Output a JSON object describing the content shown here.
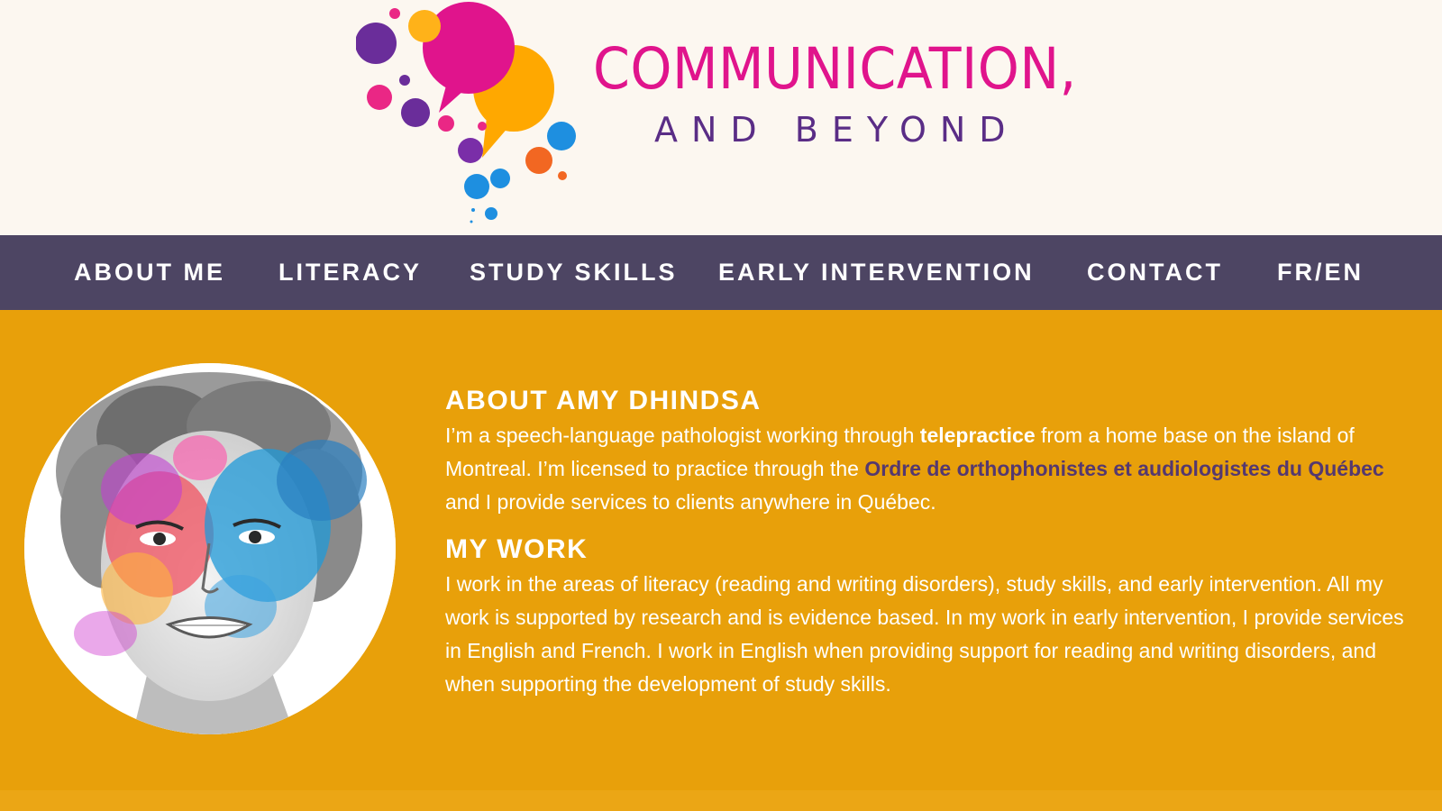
{
  "brand": {
    "title_line1": "COMMUNICATION,",
    "title_line2": "AND BEYOND",
    "colors": {
      "magenta": "#e0148c",
      "purple": "#5a2d86",
      "orange": "#ffa800",
      "blue": "#1e8fe0",
      "red_orange": "#f26722"
    }
  },
  "nav": {
    "background": "#4d4563",
    "items": [
      {
        "label": "ABOUT ME"
      },
      {
        "label": "LITERACY"
      },
      {
        "label": "STUDY SKILLS"
      },
      {
        "label": "EARLY INTERVENTION"
      },
      {
        "label": "CONTACT"
      },
      {
        "label": "FR/EN"
      }
    ]
  },
  "main": {
    "background": "#e8a00a",
    "about": {
      "heading": "ABOUT AMY DHINDSA",
      "p1_before": "I’m a speech-language pathologist working through ",
      "p1_bold": "telepractice",
      "p1_middle": " from a home base on the island of Montreal. I’m licensed to practice through the ",
      "p1_link": "Ordre de orthophonistes et audiologistes du Québec",
      "p1_after": " and I provide services to clients anywhere in Québec."
    },
    "work": {
      "heading": "MY WORK",
      "body": "I work in the areas of literacy (reading and writing disorders), study skills, and early intervention. All my work is supported by research and is evidence based. In my work in early intervention, I provide services in English and French. I work in English when providing support for reading and writing disorders, and when supporting the development of study skills."
    },
    "portrait": {
      "icon": "watercolor-portrait-illustration"
    }
  }
}
